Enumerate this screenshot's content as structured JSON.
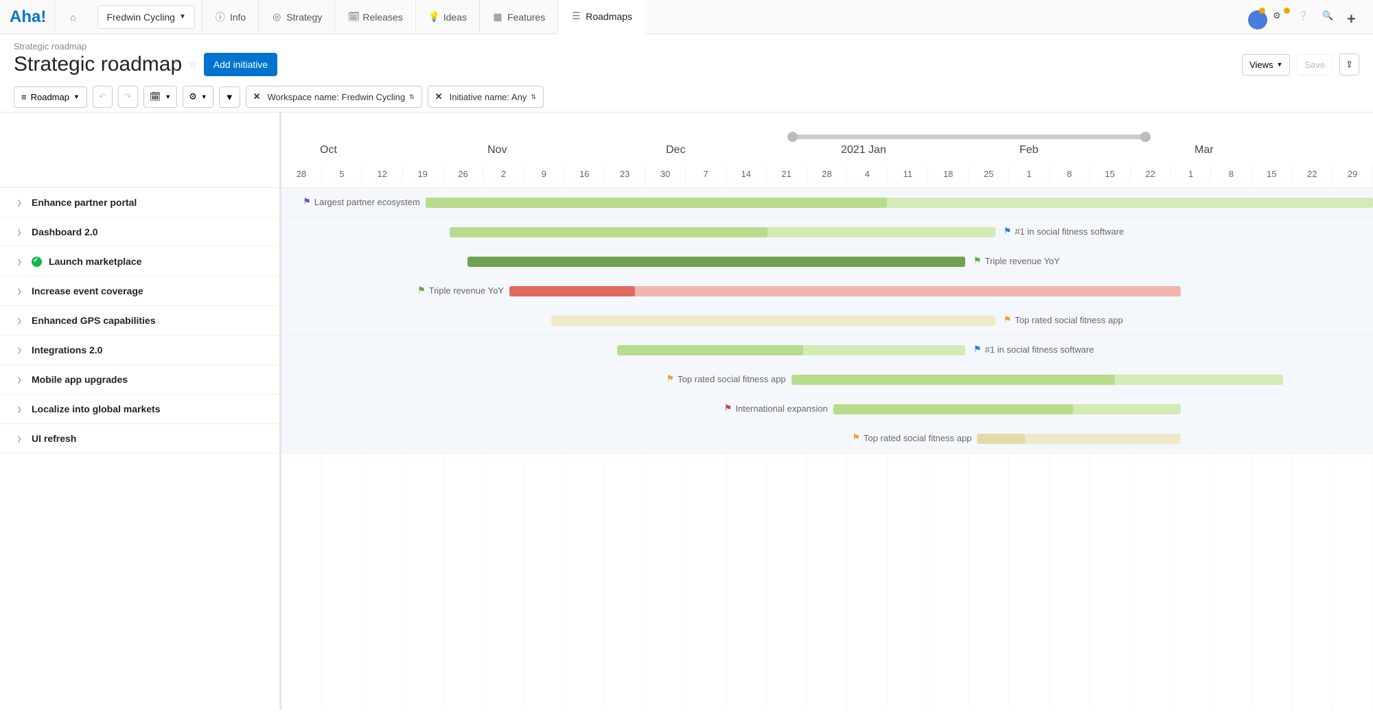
{
  "logo": "Aha!",
  "workspace": "Fredwin Cycling",
  "nav": {
    "info": "Info",
    "strategy": "Strategy",
    "releases": "Releases",
    "ideas": "Ideas",
    "features": "Features",
    "roadmaps": "Roadmaps"
  },
  "breadcrumb": "Strategic roadmap",
  "page_title": "Strategic roadmap",
  "add_initiative": "Add initiative",
  "views_label": "Views",
  "save_label": "Save",
  "toolbar": {
    "roadmap_btn": "Roadmap",
    "workspace_filter": "Workspace name: Fredwin Cycling",
    "initiative_filter": "Initiative name: Any"
  },
  "months": [
    "Oct",
    "Nov",
    "Dec",
    "2021 Jan",
    "Feb",
    "Mar"
  ],
  "days": [
    "28",
    "5",
    "12",
    "19",
    "26",
    "2",
    "9",
    "16",
    "23",
    "30",
    "7",
    "14",
    "21",
    "28",
    "4",
    "11",
    "18",
    "25",
    "1",
    "8",
    "15",
    "22",
    "1",
    "8",
    "15",
    "22",
    "29"
  ],
  "sidebar_items": [
    "Enhance partner portal",
    "Dashboard 2.0",
    "Launch marketplace",
    "Increase event coverage",
    "Enhanced GPS capabilities",
    "Integrations 2.0",
    "Mobile app upgrades",
    "Localize into global markets",
    "UI refresh"
  ],
  "bars": {
    "r0": {
      "pre_label": "Largest partner ecosystem",
      "flag": "purple"
    },
    "r1": {
      "post_label": "#1 in social fitness software",
      "flag": "blue"
    },
    "r2": {
      "post_label": "Triple revenue YoY",
      "flag": "green"
    },
    "r3": {
      "pre_label": "Triple revenue YoY",
      "flag": "green"
    },
    "r4": {
      "post_label": "Top rated social fitness app",
      "flag": "orange"
    },
    "r5": {
      "post_label": "#1 in social fitness software",
      "flag": "blue"
    },
    "r6": {
      "pre_label": "Top rated social fitness app",
      "flag": "orange"
    },
    "r7": {
      "pre_label": "International expansion",
      "flag": "red"
    },
    "r8": {
      "pre_label": "Top rated social fitness app",
      "flag": "orange"
    }
  },
  "colors": {
    "green_light": "#b7dc8c",
    "green_faint": "#d3ebb4",
    "green_dark": "#6fa154",
    "red_mid": "#e26a5f",
    "red_faint": "#f2b5ae",
    "tan": "#e3d9a6",
    "tan_faint": "#efe9c8"
  },
  "chart_data": {
    "type": "bar",
    "title": "Strategic roadmap",
    "timeline_start": "2020-09-28",
    "timeline_end": "2021-03-29",
    "months": [
      "Oct 2020",
      "Nov 2020",
      "Dec 2020",
      "Jan 2021",
      "Feb 2021",
      "Mar 2021"
    ],
    "week_ticks": [
      "2020-09-28",
      "2020-10-05",
      "2020-10-12",
      "2020-10-19",
      "2020-10-26",
      "2020-11-02",
      "2020-11-09",
      "2020-11-16",
      "2020-11-23",
      "2020-11-30",
      "2020-12-07",
      "2020-12-14",
      "2020-12-21",
      "2020-12-28",
      "2021-01-04",
      "2021-01-11",
      "2021-01-18",
      "2021-01-25",
      "2021-02-01",
      "2021-02-08",
      "2021-02-15",
      "2021-02-22",
      "2021-03-01",
      "2021-03-08",
      "2021-03-15",
      "2021-03-22",
      "2021-03-29"
    ],
    "series": [
      {
        "name": "Enhance partner portal",
        "start": "2020-10-22",
        "progress_end": "2021-01-07",
        "end": "2021-03-29",
        "status_color": "green",
        "goal": "Largest partner ecosystem",
        "goal_side": "left",
        "goal_flag": "purple"
      },
      {
        "name": "Dashboard 2.0",
        "start": "2020-10-26",
        "progress_end": "2020-12-18",
        "end": "2021-01-25",
        "status_color": "green",
        "goal": "#1 in social fitness software",
        "goal_side": "right",
        "goal_flag": "blue"
      },
      {
        "name": "Launch marketplace",
        "start": "2020-10-29",
        "progress_end": "2021-01-20",
        "end": "2021-01-20",
        "status_color": "green_dark",
        "completed": true,
        "goal": "Triple revenue YoY",
        "goal_side": "right",
        "goal_flag": "green"
      },
      {
        "name": "Increase event coverage",
        "start": "2020-11-05",
        "progress_end": "2020-11-26",
        "end": "2021-02-25",
        "status_color": "red",
        "goal": "Triple revenue YoY",
        "goal_side": "left",
        "goal_flag": "green"
      },
      {
        "name": "Enhanced GPS capabilities",
        "start": "2020-11-12",
        "progress_end": "2020-11-12",
        "end": "2021-01-25",
        "status_color": "tan",
        "goal": "Top rated social fitness app",
        "goal_side": "right",
        "goal_flag": "orange"
      },
      {
        "name": "Integrations 2.0",
        "start": "2020-11-23",
        "progress_end": "2020-12-24",
        "end": "2021-01-20",
        "status_color": "green",
        "goal": "#1 in social fitness software",
        "goal_side": "right",
        "goal_flag": "blue"
      },
      {
        "name": "Mobile app upgrades",
        "start": "2020-12-22",
        "progress_end": "2021-02-14",
        "end": "2021-03-14",
        "status_color": "green",
        "goal": "Top rated social fitness app",
        "goal_side": "left",
        "goal_flag": "orange"
      },
      {
        "name": "Localize into global markets",
        "start": "2020-12-29",
        "progress_end": "2021-02-07",
        "end": "2021-02-25",
        "status_color": "green",
        "goal": "International expansion",
        "goal_side": "left",
        "goal_flag": "red"
      },
      {
        "name": "UI refresh",
        "start": "2021-01-22",
        "progress_end": "2021-01-30",
        "end": "2021-02-25",
        "status_color": "tan",
        "goal": "Top rated social fitness app",
        "goal_side": "left",
        "goal_flag": "orange"
      }
    ]
  }
}
